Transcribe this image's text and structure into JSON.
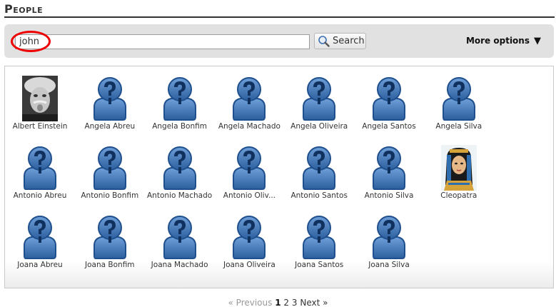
{
  "page": {
    "title": "People"
  },
  "search": {
    "value": "john",
    "button_label": "Search",
    "more_options_label": "More options",
    "more_options_caret": "▼"
  },
  "people": [
    {
      "name": "Albert Einstein",
      "avatar": "photo-einstein"
    },
    {
      "name": "Angela Abreu",
      "avatar": "person-placeholder-icon"
    },
    {
      "name": "Angela Bonfim",
      "avatar": "person-placeholder-icon"
    },
    {
      "name": "Angela Machado",
      "avatar": "person-placeholder-icon"
    },
    {
      "name": "Angela Oliveira",
      "avatar": "person-placeholder-icon"
    },
    {
      "name": "Angela Santos",
      "avatar": "person-placeholder-icon"
    },
    {
      "name": "Angela Silva",
      "avatar": "person-placeholder-icon"
    },
    {
      "name": "Antonio Abreu",
      "avatar": "person-placeholder-icon"
    },
    {
      "name": "Antonio Bonfim",
      "avatar": "person-placeholder-icon"
    },
    {
      "name": "Antonio Machado",
      "avatar": "person-placeholder-icon"
    },
    {
      "name": "Antonio Oliv...",
      "avatar": "person-placeholder-icon"
    },
    {
      "name": "Antonio Santos",
      "avatar": "person-placeholder-icon"
    },
    {
      "name": "Antonio Silva",
      "avatar": "person-placeholder-icon"
    },
    {
      "name": "Cleopatra",
      "avatar": "photo-cleopatra"
    },
    {
      "name": "Joana Abreu",
      "avatar": "person-placeholder-icon"
    },
    {
      "name": "Joana Bonfim",
      "avatar": "person-placeholder-icon"
    },
    {
      "name": "Joana Machado",
      "avatar": "person-placeholder-icon"
    },
    {
      "name": "Joana Oliveira",
      "avatar": "person-placeholder-icon"
    },
    {
      "name": "Joana Santos",
      "avatar": "person-placeholder-icon"
    },
    {
      "name": "Joana Silva",
      "avatar": "person-placeholder-icon"
    }
  ],
  "pagination": {
    "previous": "« Previous",
    "pages": [
      "1",
      "2",
      "3"
    ],
    "current": "1",
    "next": "Next »"
  },
  "colors": {
    "highlight": "#e00000",
    "avatar_blue": "#3a72b8",
    "avatar_dark": "#1f4f8c",
    "toolbar_bg": "#e1e1e1"
  }
}
